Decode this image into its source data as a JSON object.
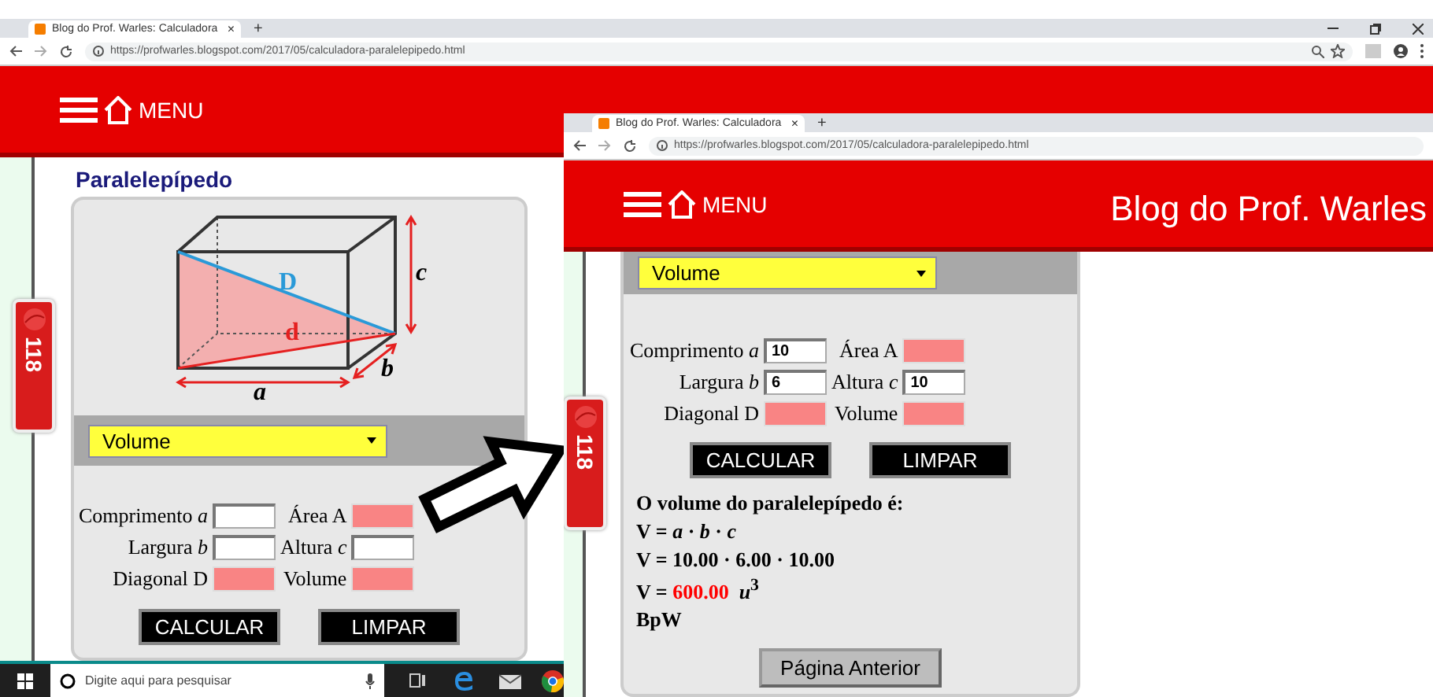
{
  "back_window": {
    "tab": {
      "title": "Blog do Prof. Warles: Calculadora",
      "close": "×"
    },
    "new_tab": "+",
    "url": "https://profwarles.blogspot.com/2017/05/calculadora-paralelepipedo.html",
    "header": {
      "menu_label": "MENU"
    },
    "side_tab": "118",
    "calculator": {
      "title": "Paralelepípedo",
      "diagram_labels": [
        {
          "kind": "height",
          "text": "c"
        },
        {
          "kind": "space_diagonal",
          "text": "D"
        },
        {
          "kind": "base_diagonal",
          "text": "d"
        },
        {
          "kind": "width",
          "text": "b"
        },
        {
          "kind": "length",
          "text": "a"
        }
      ],
      "select": "Volume",
      "fields": [
        {
          "label": "Comprimento *a*",
          "kind": "input"
        },
        {
          "label": "Área A",
          "kind": "output"
        },
        {
          "label": "Largura *b*",
          "kind": "input"
        },
        {
          "label": "Altura *c*",
          "kind": "input"
        },
        {
          "label": "Diagonal D",
          "kind": "output"
        },
        {
          "label": "Volume",
          "kind": "output"
        }
      ],
      "buttons": [
        "CALCULAR",
        "LIMPAR"
      ]
    },
    "taskbar": {
      "search_placeholder": "Digite aqui para pesquisar"
    }
  },
  "front_window": {
    "tab": {
      "title": "Blog do Prof. Warles: Calculadora",
      "close": "×"
    },
    "new_tab": "+",
    "url": "https://profwarles.blogspot.com/2017/05/calculadora-paralelepipedo.html",
    "header": {
      "menu_label": "MENU",
      "site_title": "Blog do Prof. Warles"
    },
    "side_tab": "118",
    "calculator": {
      "select": "Volume",
      "fields": [
        {
          "label": "Comprimento *a*",
          "kind": "input",
          "value": "10"
        },
        {
          "label": "Área A",
          "kind": "output"
        },
        {
          "label": "Largura *b*",
          "kind": "input",
          "value": "6"
        },
        {
          "label": "Altura *c*",
          "kind": "input",
          "value": "10"
        },
        {
          "label": "Diagonal D",
          "kind": "output"
        },
        {
          "label": "Volume",
          "kind": "output"
        }
      ],
      "buttons": [
        "CALCULAR",
        "LIMPAR"
      ],
      "result": [
        {
          "kind": "heading",
          "text": "O volume do paralelepípedo é:"
        },
        {
          "kind": "formula",
          "text": "V = *a* · *b* · *c*"
        },
        {
          "kind": "formula",
          "text": "V = 10.00 · 6.00 · 10.00"
        },
        {
          "kind": "value",
          "prefix": "V =",
          "value": "600.00",
          "unit": "*u*$^{3}$"
        },
        {
          "kind": "formula",
          "text": "BpW"
        }
      ],
      "back_button": "Página Anterior"
    }
  }
}
